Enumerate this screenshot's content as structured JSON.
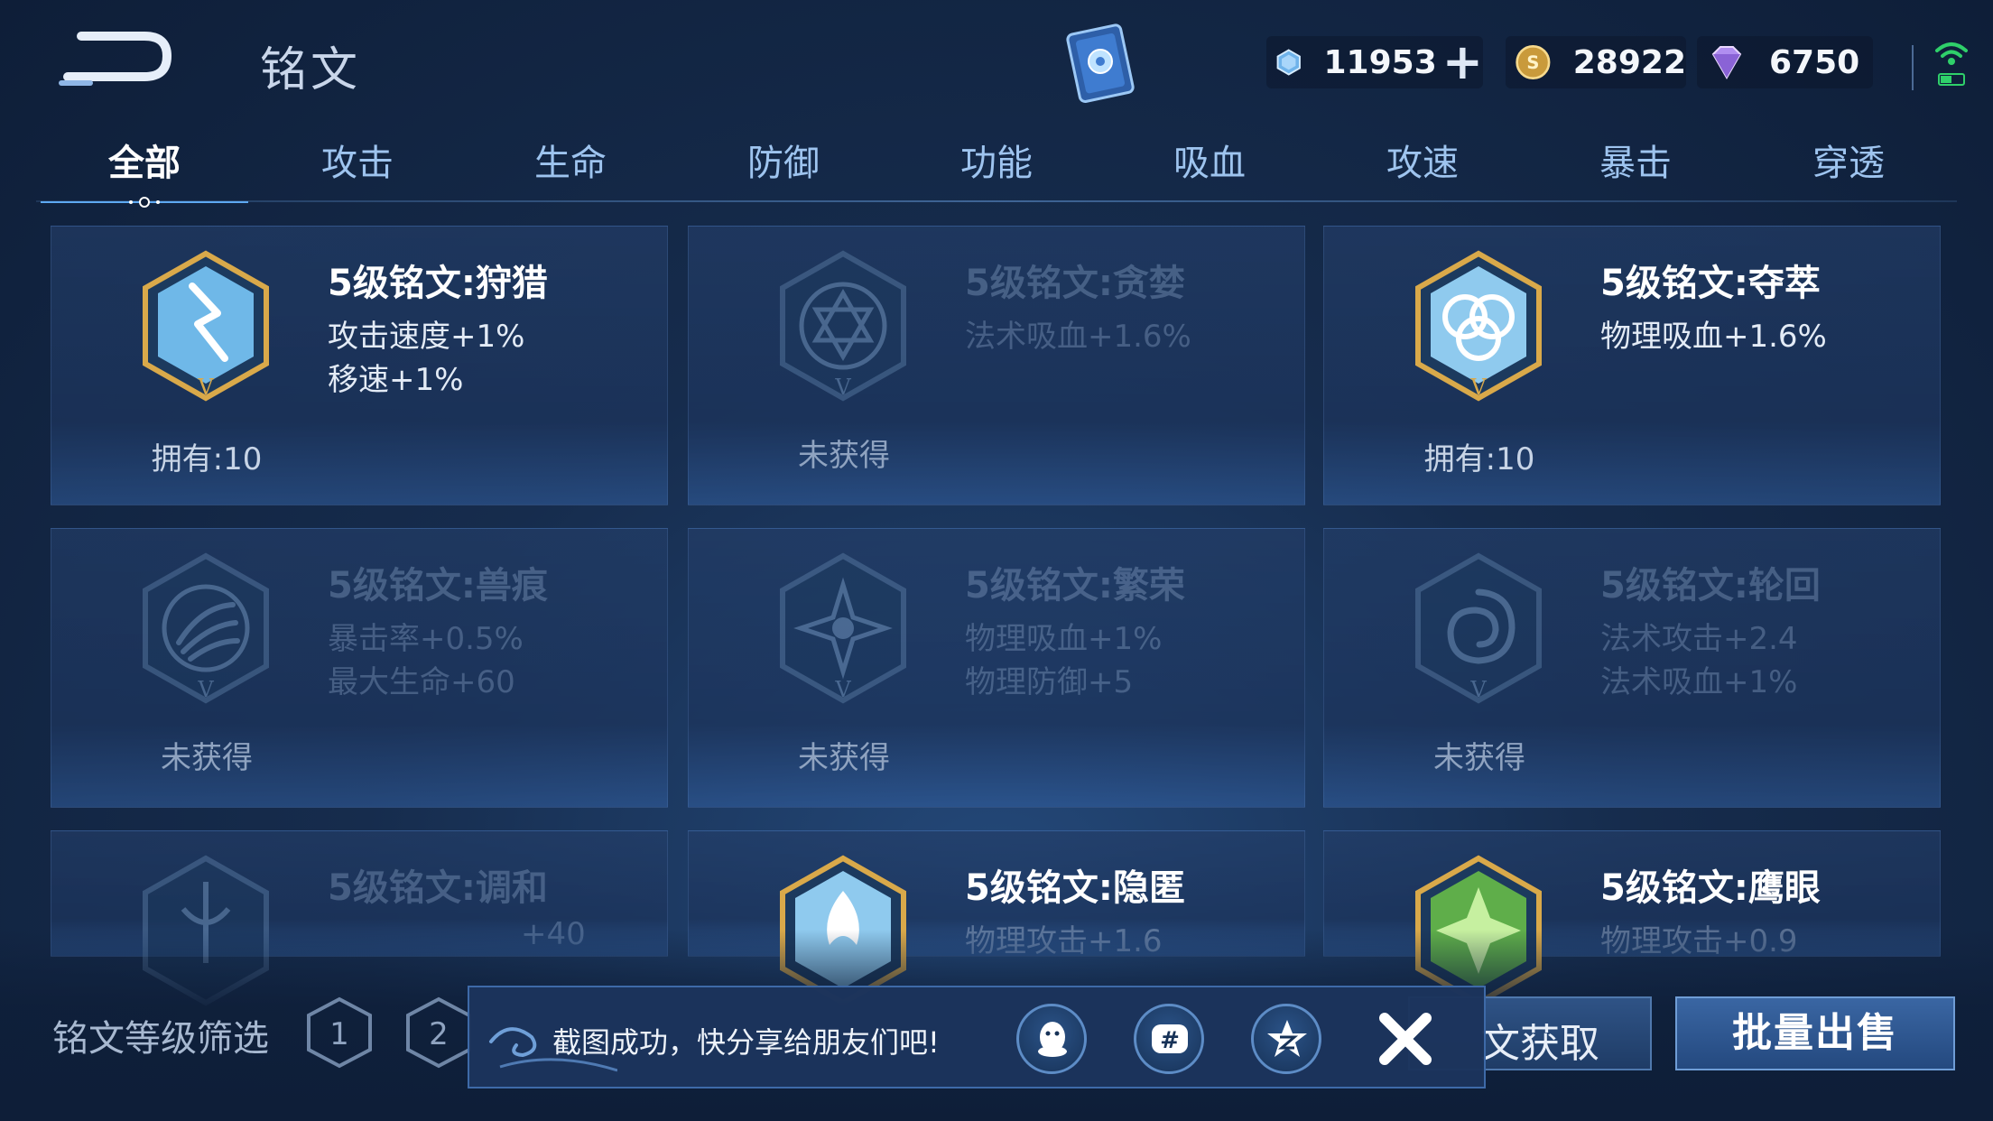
{
  "header": {
    "title": "铭文",
    "currencies": [
      {
        "icon": "coupon-diamond-icon",
        "value": "11953",
        "has_plus": true
      },
      {
        "icon": "gold-coin-icon",
        "value": "28922"
      },
      {
        "icon": "purple-gem-icon",
        "value": "6750"
      }
    ]
  },
  "tabs": [
    "全部",
    "攻击",
    "生命",
    "防御",
    "功能",
    "吸血",
    "攻速",
    "暴击",
    "穿透"
  ],
  "active_tab": "全部",
  "cards": [
    {
      "title": "5级铭文:狩猎",
      "stats": [
        "攻击速度+1%",
        "移速+1%"
      ],
      "owned": "拥有:10",
      "locked": false,
      "color": "#d9a94a"
    },
    {
      "title": "5级铭文:贪婪",
      "stats": [
        "法术吸血+1.6%"
      ],
      "owned": "未获得",
      "locked": true,
      "color": "#5d80a8"
    },
    {
      "title": "5级铭文:夺萃",
      "stats": [
        "物理吸血+1.6%"
      ],
      "owned": "拥有:10",
      "locked": false,
      "color": "#d9a94a"
    },
    {
      "title": "5级铭文:兽痕",
      "stats": [
        "暴击率+0.5%",
        "最大生命+60"
      ],
      "owned": "未获得",
      "locked": true,
      "color": "#5d80a8"
    },
    {
      "title": "5级铭文:繁荣",
      "stats": [
        "物理吸血+1%",
        "物理防御+5"
      ],
      "owned": "未获得",
      "locked": true,
      "color": "#5d80a8"
    },
    {
      "title": "5级铭文:轮回",
      "stats": [
        "法术攻击+2.4",
        "法术吸血+1%"
      ],
      "owned": "未获得",
      "locked": true,
      "color": "#5d80a8"
    },
    {
      "title": "5级铭文:调和",
      "stats": [
        "+40"
      ],
      "locked": true
    },
    {
      "title": "5级铭文:隐匿",
      "stats": [
        "物理攻击+1.6"
      ],
      "locked": false
    },
    {
      "title": "5级铭文:鹰眼",
      "stats": [
        "物理攻击+0.9"
      ],
      "locked": false
    }
  ],
  "bottom": {
    "filter_label": "铭文等级筛选",
    "levels": [
      "1",
      "2"
    ],
    "obtain_label": "文获取",
    "sell_label": "批量出售"
  },
  "toast": {
    "message": "截图成功，快分享给朋友们吧!",
    "share_targets": [
      "qq-icon",
      "hashtag-icon",
      "qzone-star-icon"
    ]
  },
  "colors": {
    "background": "#162c4d",
    "accent": "#5d8cc6",
    "gold": "#d9a94a",
    "tab_text": "#9ec4ef"
  }
}
